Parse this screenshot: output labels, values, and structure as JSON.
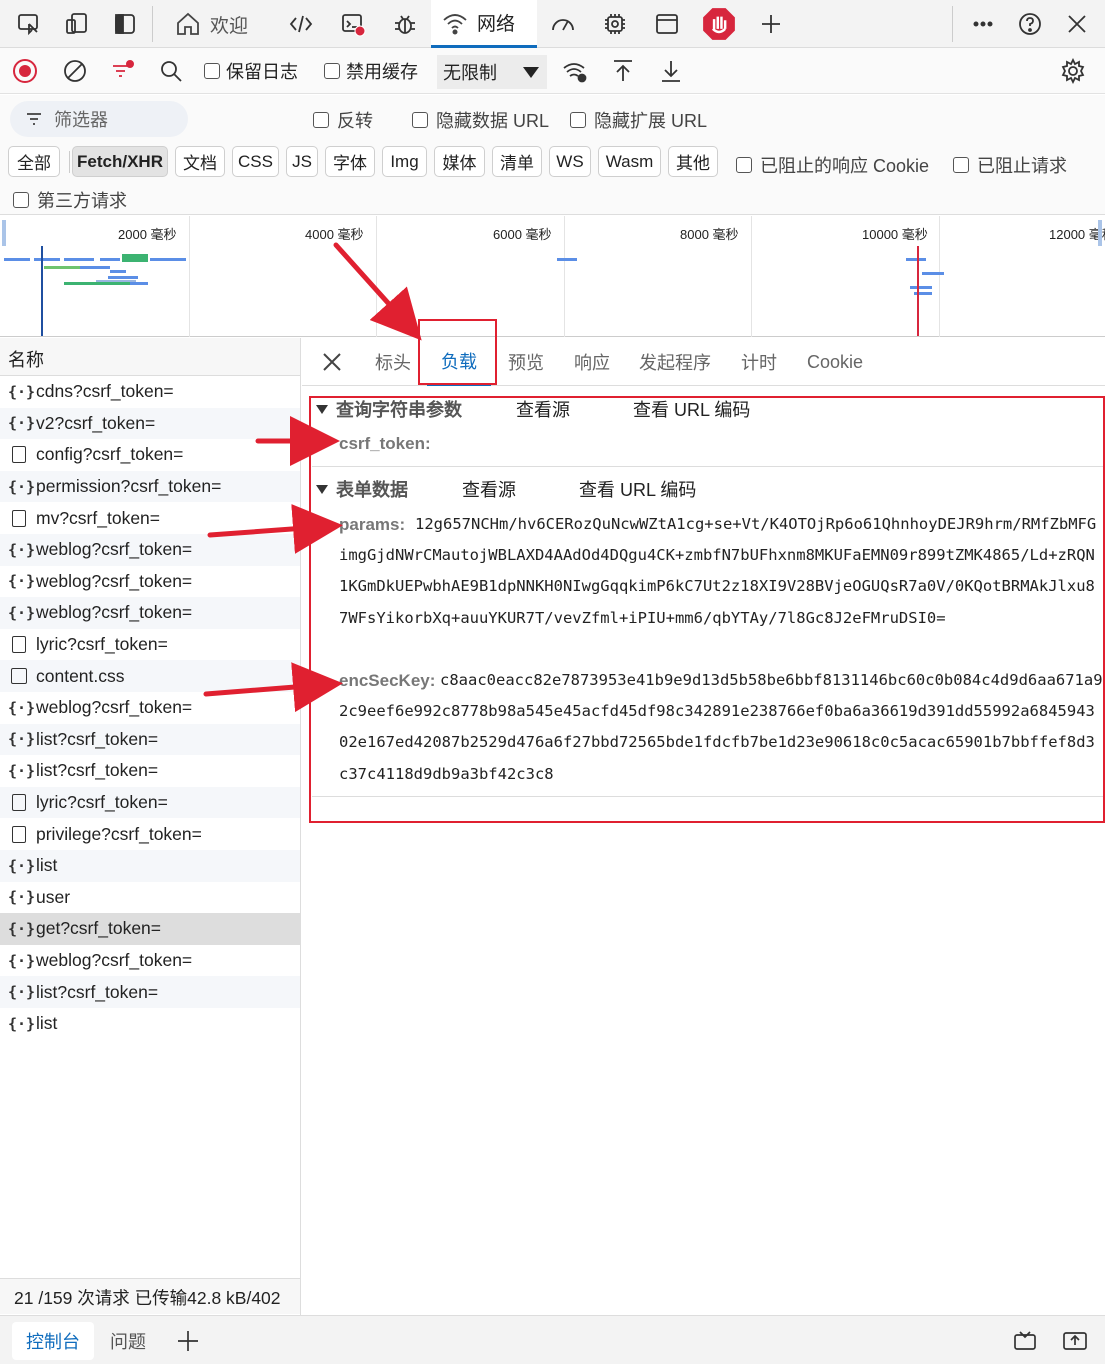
{
  "topbar": {
    "tabs": [
      {
        "label": "欢迎"
      },
      {
        "label": "网络"
      }
    ]
  },
  "toolbar": {
    "preserve_log": "保留日志",
    "disable_cache": "禁用缓存",
    "throttle": "无限制"
  },
  "filter": {
    "placeholder": "筛选器",
    "invert": "反转",
    "hide_data_urls": "隐藏数据 URL",
    "hide_ext_urls": "隐藏扩展 URL"
  },
  "chips": [
    "全部",
    "Fetch/XHR",
    "文档",
    "CSS",
    "JS",
    "字体",
    "Img",
    "媒体",
    "清单",
    "WS",
    "Wasm",
    "其他"
  ],
  "chip_checks": {
    "blocked_cookies": "已阻止的响应 Cookie",
    "blocked_requests": "已阻止请求",
    "third_party": "第三方请求"
  },
  "overview": {
    "ticks": [
      "2000 毫秒",
      "4000 毫秒",
      "6000 毫秒",
      "8000 毫秒",
      "10000 毫秒",
      "12000 毫秒"
    ]
  },
  "requests": {
    "header": "名称",
    "rows": [
      {
        "name": "cdns?csrf_token=",
        "icon": "xhr-icon"
      },
      {
        "name": "v2?csrf_token=",
        "icon": "xhr-icon"
      },
      {
        "name": "config?csrf_token=",
        "icon": "document-icon"
      },
      {
        "name": "permission?csrf_token=",
        "icon": "xhr-icon"
      },
      {
        "name": "mv?csrf_token=",
        "icon": "document-icon"
      },
      {
        "name": "weblog?csrf_token=",
        "icon": "xhr-icon"
      },
      {
        "name": "weblog?csrf_token=",
        "icon": "xhr-icon"
      },
      {
        "name": "weblog?csrf_token=",
        "icon": "xhr-icon"
      },
      {
        "name": "lyric?csrf_token=",
        "icon": "document-icon"
      },
      {
        "name": "content.css",
        "icon": "stylesheet-icon"
      },
      {
        "name": "weblog?csrf_token=",
        "icon": "xhr-icon"
      },
      {
        "name": "list?csrf_token=",
        "icon": "xhr-icon"
      },
      {
        "name": "list?csrf_token=",
        "icon": "xhr-icon"
      },
      {
        "name": "lyric?csrf_token=",
        "icon": "document-icon"
      },
      {
        "name": "privilege?csrf_token=",
        "icon": "document-icon"
      },
      {
        "name": "list",
        "icon": "xhr-icon"
      },
      {
        "name": "user",
        "icon": "xhr-icon"
      },
      {
        "name": "get?csrf_token=",
        "icon": "xhr-icon"
      },
      {
        "name": "weblog?csrf_token=",
        "icon": "xhr-icon"
      },
      {
        "name": "list?csrf_token=",
        "icon": "xhr-icon"
      },
      {
        "name": "list",
        "icon": "xhr-icon"
      }
    ],
    "status": "21 /159 次请求  已传输42.8 kB/402"
  },
  "detail": {
    "tabs": [
      "标头",
      "负载",
      "预览",
      "响应",
      "发起程序",
      "计时",
      "Cookie"
    ],
    "query_section": {
      "title": "查询字符串参数",
      "view_source": "查看源",
      "view_url_encoded": "查看 URL 编码",
      "key": "csrf_token:"
    },
    "form_section": {
      "title": "表单数据",
      "view_source": "查看源",
      "view_url_encoded": "查看 URL 编码",
      "params_key": "params:",
      "params_value": "12g657NCHm/hv6CERozQuNcwWZtA1cg+se+Vt/K4OTOjRp6o61QhnhoyDEJR9hrm/RMfZbMFGimgGjdNWrCMautojWBLAXD4AAdOd4DQgu4CK+zmbfN7bUFhxnm8MKUFaEMN09r899tZMK4865/Ld+zRQN1KGmDkUEPwbhAE9B1dpNNKH0NIwgGqqkimP6kC7Ut2z18XI9V28BVjeOGUQsR7a0V/0KQotBRMAkJlxu87WFsYikorbXq+auuYKUR7T/vevZfml+iPIU+mm6/qbYTAy/7l8Gc8J2eFMruDSI0=",
      "enckey_key": "encSecKey:",
      "enckey_value": "c8aac0eacc82e7873953e41b9e9d13d5b58be6bbf8131146bc60c0b084c4d9d6aa671a92c9eef6e992c8778b98a545e45acfd45df98c342891e238766ef0ba6a36619d391dd55992a684594302e167ed42087b2529d476a6f27bbd72565bde1fdcfb7be1d23e90618c0c5acac65901b7bbffef8d3c37c4118d9db9a3bf42c3c8"
    }
  },
  "bottom": {
    "tabs": [
      "控制台",
      "问题"
    ]
  },
  "colors": {
    "accent": "#0f6cbd",
    "annotation": "#e02030",
    "record": "#d7263d"
  }
}
